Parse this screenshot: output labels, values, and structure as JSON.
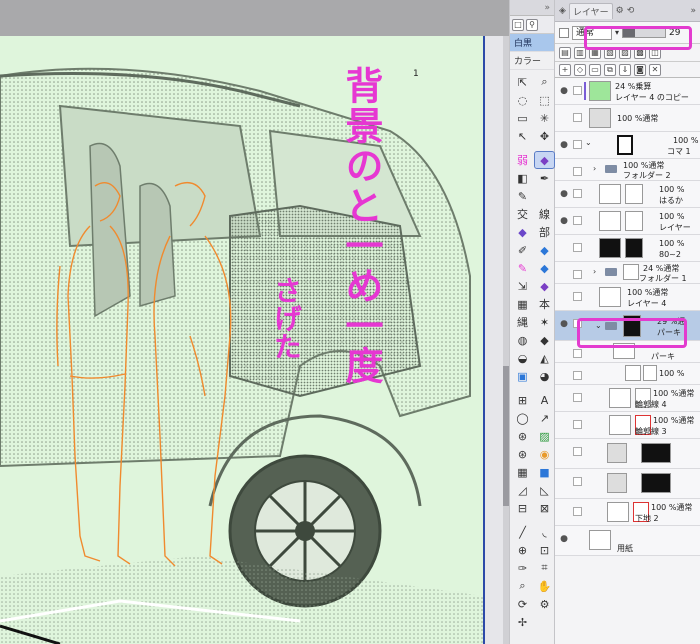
{
  "colors": {
    "canvas_bg": "#dff5dc",
    "accent_selection": "#b7cbe6",
    "annotation_magenta": "#e637d2",
    "sketch_orange": "#f08a2e"
  },
  "handwritten_notes": {
    "line1": "背景のと一め一度",
    "line2": "さげた"
  },
  "canvas": {
    "page_number": "1"
  },
  "tool_column": {
    "subtools": [
      {
        "label": "白黒",
        "active": true
      },
      {
        "label": "カラー",
        "active": false
      }
    ],
    "icons": [
      "move-icon",
      "zoom-icon",
      "lasso-icon",
      "select-icon",
      "rect-select-icon",
      "sparkle-icon",
      "wand-icon",
      "move-arrows-icon",
      "brush-weak-icon",
      "brush-purple-icon",
      "pen-icon",
      "pen-bold-icon",
      "pencil-icon",
      "x-icon",
      "crosshatch-icon",
      "line-icon",
      "diamond-icon",
      "part-icon",
      "ink-icon",
      "blue-diamond-icon",
      "marker-icon",
      "dark-marker-icon",
      "fill-icon",
      "fill-purple-icon",
      "grid-icon",
      "book-icon",
      "eraser-icon",
      "star-icon",
      "blend-icon",
      "smudge-icon",
      "gradient-icon",
      "bucket-icon",
      "text-icon",
      "speech-icon",
      "pattern-icon",
      "hatch-icon",
      "halftone-icon",
      "circle-icon",
      "dots-icon",
      "blue-square-icon",
      "triangle-icon",
      "frame-icon",
      "ruler-icon",
      "panel-icon",
      "line-tool-icon",
      "curve-icon",
      "shape-icon",
      "polyline-icon",
      "eyedropper-icon",
      "grid-tool-icon",
      "magnifier-icon",
      "hand-icon",
      "rotate-icon",
      "navigator-icon",
      "move-layer-icon"
    ]
  },
  "layer_panel": {
    "tab_label": "レイヤー",
    "blend_mode": "通常",
    "opacity": "29",
    "layers": [
      {
        "pct": "24 %",
        "mode": "乗算",
        "name": "レイヤー 4 のコピー",
        "thumb": "green",
        "indent": 0
      },
      {
        "pct": "100 %",
        "mode": "通常",
        "name": "",
        "thumb": "white",
        "indent": 0
      },
      {
        "pct": "100 %",
        "mode": "",
        "name": "コマ 1",
        "thumb": "dark-frame",
        "indent": 0
      },
      {
        "pct": "100 %",
        "mode": "通常",
        "name": "フォルダー 2",
        "thumb": "folder",
        "indent": 1
      },
      {
        "pct": "100 %",
        "mode": "",
        "name": "はるか",
        "thumb": "white",
        "indent": 2
      },
      {
        "pct": "100 %",
        "mode": "",
        "name": "レイヤー",
        "thumb": "white",
        "indent": 2
      },
      {
        "pct": "100 %",
        "mode": "",
        "name": "80~2",
        "thumb": "dark",
        "indent": 2
      },
      {
        "pct": "24 %",
        "mode": "通常",
        "name": "フォルダー 1",
        "thumb": "folder",
        "indent": 1
      },
      {
        "pct": "100 %",
        "mode": "通常",
        "name": "レイヤー 4",
        "thumb": "white",
        "indent": 2
      },
      {
        "pct": "29 %",
        "mode": "通",
        "name": "パーキ",
        "thumb": "folder-dark",
        "indent": 1,
        "selected": true
      },
      {
        "pct": "",
        "mode": "",
        "name": "パーキ",
        "thumb": "white",
        "indent": 3
      },
      {
        "pct": "100 %",
        "mode": "",
        "name": "",
        "thumb": "white",
        "indent": 3
      },
      {
        "pct": "100 %",
        "mode": "通常",
        "name": "輪郭線 4",
        "thumb": "white",
        "indent": 3
      },
      {
        "pct": "100 %",
        "mode": "通常",
        "name": "輪郭線 3",
        "thumb": "white",
        "indent": 3
      },
      {
        "pct": "",
        "mode": "",
        "name": "",
        "thumb": "dark",
        "indent": 2
      },
      {
        "pct": "",
        "mode": "",
        "name": "",
        "thumb": "dark",
        "indent": 2
      },
      {
        "pct": "100 %",
        "mode": "通常",
        "name": "下地 2",
        "thumb": "white",
        "indent": 2
      },
      {
        "pct": "",
        "mode": "",
        "name": "用紙",
        "thumb": "white",
        "indent": 0
      }
    ]
  }
}
